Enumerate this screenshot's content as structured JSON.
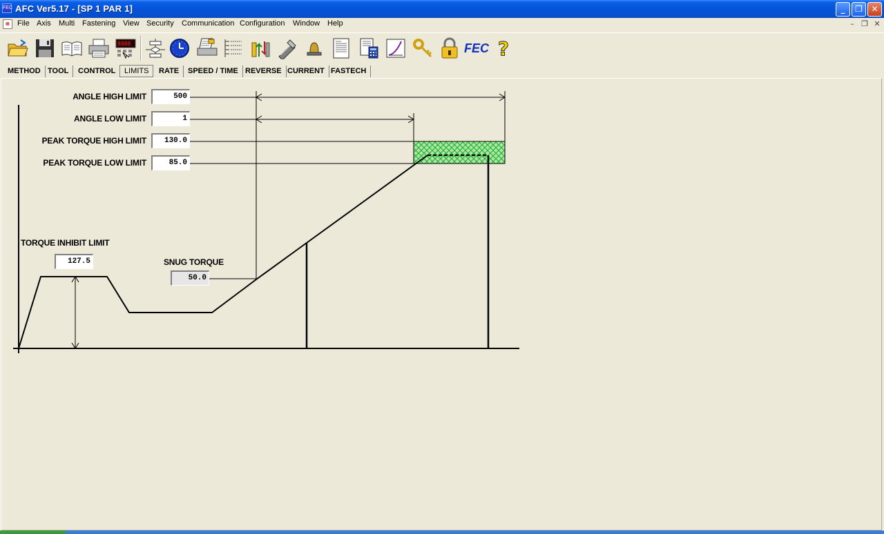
{
  "window": {
    "title": "AFC Ver5.17 - [SP 1 PAR 1]",
    "app_icon": "afc-app-icon",
    "minimize": "_",
    "restore": "❐",
    "close": "✕"
  },
  "menu": {
    "items": [
      "File",
      "Axis",
      "Multi",
      "Fastening",
      "View",
      "Security",
      "Communication",
      "Configuration",
      "Window",
      "Help"
    ],
    "mdi_min": "–",
    "mdi_restore": "❐",
    "mdi_close": "✕"
  },
  "toolbar": {
    "buttons": [
      "open-folder-icon",
      "save-disk-icon",
      "book-icon",
      "printer-icon",
      "display-panel-icon",
      "flowchart-icon",
      "clock-icon",
      "printer-settings-icon",
      "list-icon",
      "axis-arrows-icon",
      "wrench-tool-icon",
      "bell-icon",
      "document-icon",
      "calculator-document-icon",
      "curve-graph-icon",
      "key-icon",
      "padlock-icon",
      "fec-logo-icon",
      "help-question-icon"
    ],
    "fec_text": "FEC",
    "help_text": "?"
  },
  "tabs": [
    "METHOD",
    "TOOL",
    "CONTROL",
    "LIMITS",
    "RATE",
    "SPEED / TIME",
    "REVERSE",
    "CURRENT",
    "FASTECH"
  ],
  "active_tab": "LIMITS",
  "limits": {
    "angle_high_label": "ANGLE HIGH LIMIT",
    "angle_high_value": "500",
    "angle_low_label": "ANGLE LOW LIMIT",
    "angle_low_value": "1",
    "peak_high_label": "PEAK TORQUE HIGH LIMIT",
    "peak_high_value": "130.0",
    "peak_low_label": "PEAK TORQUE LOW LIMIT",
    "peak_low_value": "85.0",
    "inhibit_label": "TORQUE INHIBIT LIMIT",
    "inhibit_value": "127.5",
    "snug_label": "SNUG TORQUE",
    "snug_value": "50.0"
  },
  "colors": {
    "titlebar": "#0553D8",
    "background": "#ECE9D8",
    "window_zone": "#A8E8A8",
    "window_hatch": "#22AA22"
  }
}
